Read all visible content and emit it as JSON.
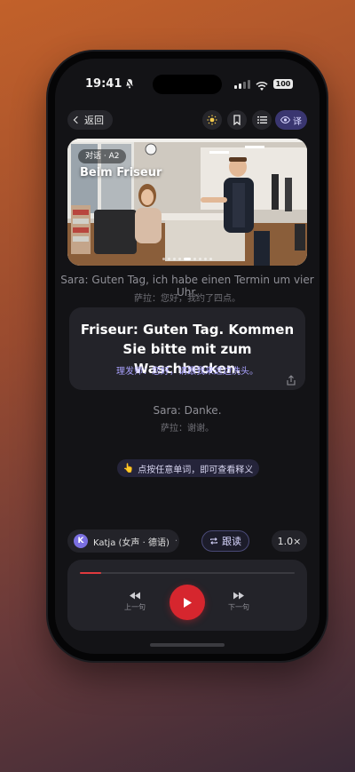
{
  "status": {
    "time": "19:41",
    "battery": "100"
  },
  "topbar": {
    "back_label": "返回",
    "translate_label": "译"
  },
  "hero": {
    "tag": "对话 · A2",
    "title": "Beim Friseur"
  },
  "dialogue": [
    {
      "de": "Sara: Guten Tag, ich habe einen Termin um vier Uhr.",
      "zh": "萨拉：您好，我约了四点。"
    },
    {
      "de": "Friseur: Guten Tag. Kommen Sie bitte mit zum Waschbecken.",
      "zh": "理发师：您好，请跟我来这边洗头。"
    },
    {
      "de": "Sara: Danke.",
      "zh": "萨拉：谢谢。"
    }
  ],
  "hint": {
    "text": "点按任意单词，即可查看释义"
  },
  "voice": {
    "avatar_letter": "K",
    "label": "Katja (女声 · 德语)"
  },
  "shadow_label": "跟读",
  "speed": "1.0×",
  "player": {
    "prev_label": "上一句",
    "next_label": "下一句",
    "progress": 0.1
  },
  "colors": {
    "accent": "#d6262e",
    "highlight": "#a9a2ff",
    "card": "#232329"
  }
}
